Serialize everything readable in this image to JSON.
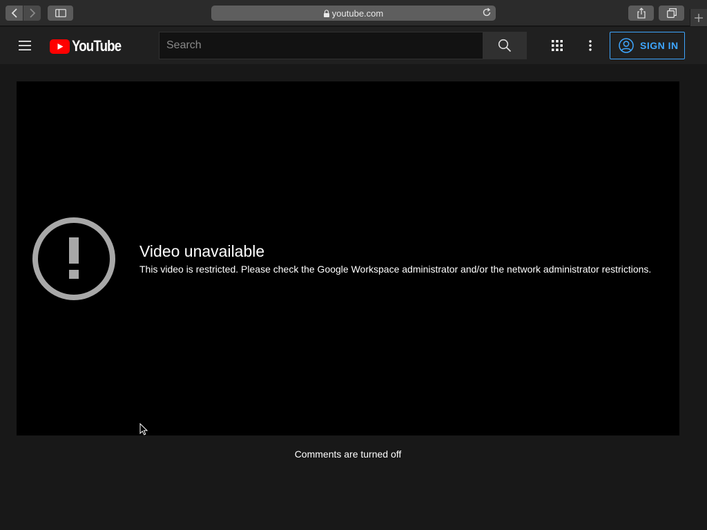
{
  "browser": {
    "address": "youtube.com"
  },
  "header": {
    "logo_text": "YouTube",
    "search_placeholder": "Search",
    "signin_label": "SIGN IN"
  },
  "player": {
    "error_title": "Video unavailable",
    "error_message": "This video is restricted. Please check the Google Workspace administrator and/or the network administrator restrictions."
  },
  "comments": {
    "status": "Comments are turned off"
  },
  "icons": {
    "back": "chevron-left-icon",
    "forward": "chevron-right-icon",
    "sidebar": "sidebar-icon",
    "lock": "lock-icon",
    "reload": "reload-icon",
    "share": "share-icon",
    "tabs": "tabs-icon",
    "new_tab": "plus-icon",
    "menu": "hamburger-menu-icon",
    "search": "search-icon",
    "apps": "apps-grid-icon",
    "more": "more-vertical-icon",
    "account": "account-circle-icon",
    "error": "exclamation-circle-icon"
  },
  "colors": {
    "accent": "#3ea6ff",
    "brand_red": "#ff0000",
    "page_bg": "#181818",
    "header_bg": "#202020"
  }
}
